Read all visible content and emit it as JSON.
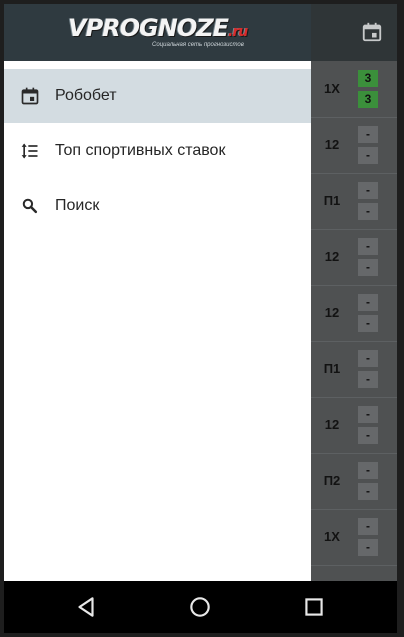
{
  "app": {
    "rows": [
      {
        "bet": "1X",
        "scores": [
          "3",
          "3"
        ],
        "win": true
      },
      {
        "bet": "12",
        "scores": [
          "-",
          "-"
        ],
        "win": false
      },
      {
        "bet": "П1",
        "scores": [
          "-",
          "-"
        ],
        "win": false
      },
      {
        "bet": "12",
        "scores": [
          "-",
          "-"
        ],
        "win": false
      },
      {
        "bet": "12",
        "scores": [
          "-",
          "-"
        ],
        "win": false
      },
      {
        "bet": "П1",
        "scores": [
          "-",
          "-"
        ],
        "win": false
      },
      {
        "bet": "12",
        "scores": [
          "-",
          "-"
        ],
        "win": false
      },
      {
        "bet": "П2",
        "scores": [
          "-",
          "-"
        ],
        "win": false
      },
      {
        "bet": "1X",
        "scores": [
          "-",
          "-"
        ],
        "win": false
      }
    ]
  },
  "drawer": {
    "logo_main": "VPROGNOZE",
    "logo_suffix": ".ru",
    "logo_tagline": "Социальная сеть прогнозистов",
    "items": [
      {
        "label": "Робобет",
        "icon": "calendar-icon",
        "active": true
      },
      {
        "label": "Топ спортивных ставок",
        "icon": "sort-list-icon",
        "active": false
      },
      {
        "label": "Поиск",
        "icon": "search-icon",
        "active": false
      }
    ]
  },
  "colors": {
    "header_bg": "#2f3a40",
    "active_item_bg": "#d3dce1",
    "win_badge": "#3b8f3b",
    "logo_accent": "#d62b2b"
  }
}
